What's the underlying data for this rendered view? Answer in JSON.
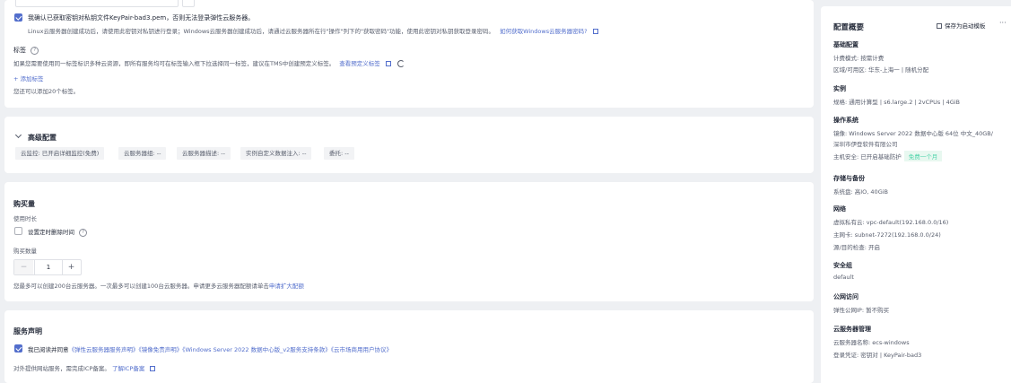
{
  "colors": {
    "accent": "#526ecc",
    "success_bg": "#e8f8f0",
    "success_text": "#3fbf8c"
  },
  "left": {
    "top_input_value": "",
    "keypair": {
      "confirm_text": "我确认已获取密钥对私钥文件KeyPair-bad3.pem，否则无法登录弹性云服务器。",
      "note_text": "Linux云服务器创建成功后，请使用此密钥对私钥进行登录；Windows云服务器创建成功后，请通过云服务器所在行\"操作\"列下的\"获取密码\"功能，使用此密钥对私钥获取登录密码。",
      "note_link": "如何获取Windows云服务器密码?"
    },
    "tags": {
      "label": "标签",
      "desc": "如果您需要使用同一标签标识多种云资源，即所有服务均可在标签输入框下拉选择同一标签，建议在TMS中创建预定义标签。",
      "view_link": "查看预定义标签",
      "add_link": "+ 添加标签",
      "limit": "您还可以添加20个标签。"
    },
    "advanced": {
      "title": "高级配置",
      "chips": [
        "云监控: 已开启详细监控(免费)",
        "云服务器组: --",
        "云服务器描述: --",
        "实例自定义数据注入: --",
        "委托: --"
      ]
    },
    "purchase": {
      "title": "购买量",
      "duration_label": "使用时长",
      "schedule_delete": "设置定时删除时间",
      "qty_label": "购买数量",
      "qty_minus": "−",
      "qty_value": "1",
      "qty_plus": "+",
      "limit_text": "您最多可以创建200台云服务器。一次最多可以创建100台云服务器。申请更多云服务器配额请单击",
      "limit_link": "申请扩大配额"
    },
    "service": {
      "title": "服务声明",
      "agree_prefix": "我已阅读并同意",
      "agree_links": "《弹性云服务器服务声明》《镜像免责声明》《Windows Server 2022 数据中心版_v2服务支持条款》《云市场商用用户协议》",
      "icp_text": "对外提供网站服务，需完成ICP备案。",
      "icp_link": "了解ICP备案"
    }
  },
  "summary": {
    "title": "配置概要",
    "save_template": "保存为启动模板",
    "more": "···",
    "basic": {
      "title": "基础配置",
      "billing": "计费模式: 按需计费",
      "region": "区域/可用区: 华东-上海一 | 随机分配"
    },
    "instance": {
      "title": "实例",
      "spec": "规格: 通用计算型 | s6.large.2 | 2vCPUs | 4GiB"
    },
    "os": {
      "title": "操作系统",
      "image_line1": "镜像: Windows Server 2022 数据中心版 64位 中文_40GB/",
      "image_line2": "深圳市伊登软件有限公司",
      "host_security": "主机安全: 已开启基础防护",
      "free_badge": "免费一个月"
    },
    "storage": {
      "title": "存储与备份",
      "disk": "系统盘: 高IO, 40GiB"
    },
    "network": {
      "title": "网络",
      "vpc": "虚拟私有云: vpc-default(192.168.0.0/16)",
      "nic": "主网卡: subnet-7272(192.168.0.0/24)",
      "src_check": "源/目的检查: 开启"
    },
    "security_group": {
      "title": "安全组",
      "value": "default"
    },
    "public": {
      "title": "公网访问",
      "eip": "弹性公网IP: 暂不购买"
    },
    "mgmt": {
      "title": "云服务器管理",
      "name": "云服务器名称: ecs-windows",
      "login": "登录凭证: 密钥对 | KeyPair-bad3"
    }
  }
}
